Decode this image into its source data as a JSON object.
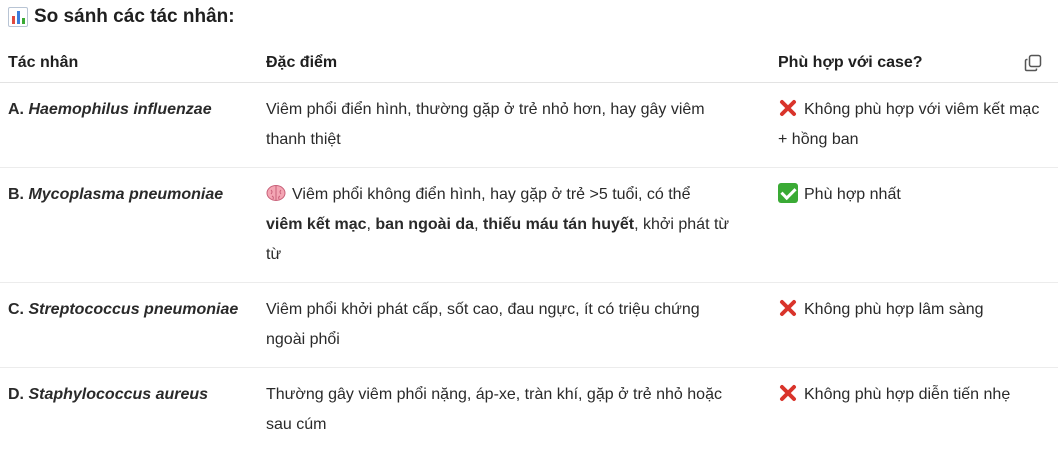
{
  "heading": {
    "text": "So sánh các tác nhân:",
    "icon": "bar-chart-icon"
  },
  "table": {
    "headers": [
      "Tác nhân",
      "Đặc điểm",
      "Phù hợp với case?"
    ],
    "rows": [
      {
        "agent_prefix": "A. ",
        "agent_name": "Haemophilus influenzae",
        "features": [
          {
            "text": "Viêm phổi điển hình, thường gặp ở trẻ nhỏ hơn, hay gây viêm thanh thiệt",
            "bold": false
          }
        ],
        "fit_icon": "cross-mark-icon",
        "fit": "Không phù hợp với viêm kết mạc + hồng ban"
      },
      {
        "agent_prefix": "B. ",
        "agent_name": "Mycoplasma pneumoniae",
        "features_icon": "brain-icon",
        "features": [
          {
            "text": "Viêm phổi không điển hình, hay gặp ở trẻ >5 tuổi, có thể ",
            "bold": false
          },
          {
            "text": "viêm kết mạc",
            "bold": true
          },
          {
            "text": ", ",
            "bold": false
          },
          {
            "text": "ban ngoài da",
            "bold": true
          },
          {
            "text": ", ",
            "bold": false
          },
          {
            "text": "thiếu máu tán huyết",
            "bold": true
          },
          {
            "text": ", khởi phát từ từ",
            "bold": false
          }
        ],
        "fit_icon": "check-mark-icon",
        "fit": "Phù hợp nhất"
      },
      {
        "agent_prefix": "C. ",
        "agent_name": "Streptococcus pneumoniae",
        "features": [
          {
            "text": "Viêm phổi khởi phát cấp, sốt cao, đau ngực, ít có triệu chứng ngoài phổi",
            "bold": false
          }
        ],
        "fit_icon": "cross-mark-icon",
        "fit": "Không phù hợp lâm sàng"
      },
      {
        "agent_prefix": "D. ",
        "agent_name": "Staphylococcus aureus",
        "features": [
          {
            "text": "Thường gây viêm phổi nặng, áp-xe, tràn khí, gặp ở trẻ nhỏ hoặc sau cúm",
            "bold": false
          }
        ],
        "fit_icon": "cross-mark-icon",
        "fit": "Không phù hợp diễn tiến nhẹ"
      }
    ]
  },
  "toolbar": {
    "copy_icon": "copy-icon"
  },
  "colors": {
    "cross": "#d9342b",
    "check": "#3aaa35",
    "brain": "#f4a6b4"
  }
}
